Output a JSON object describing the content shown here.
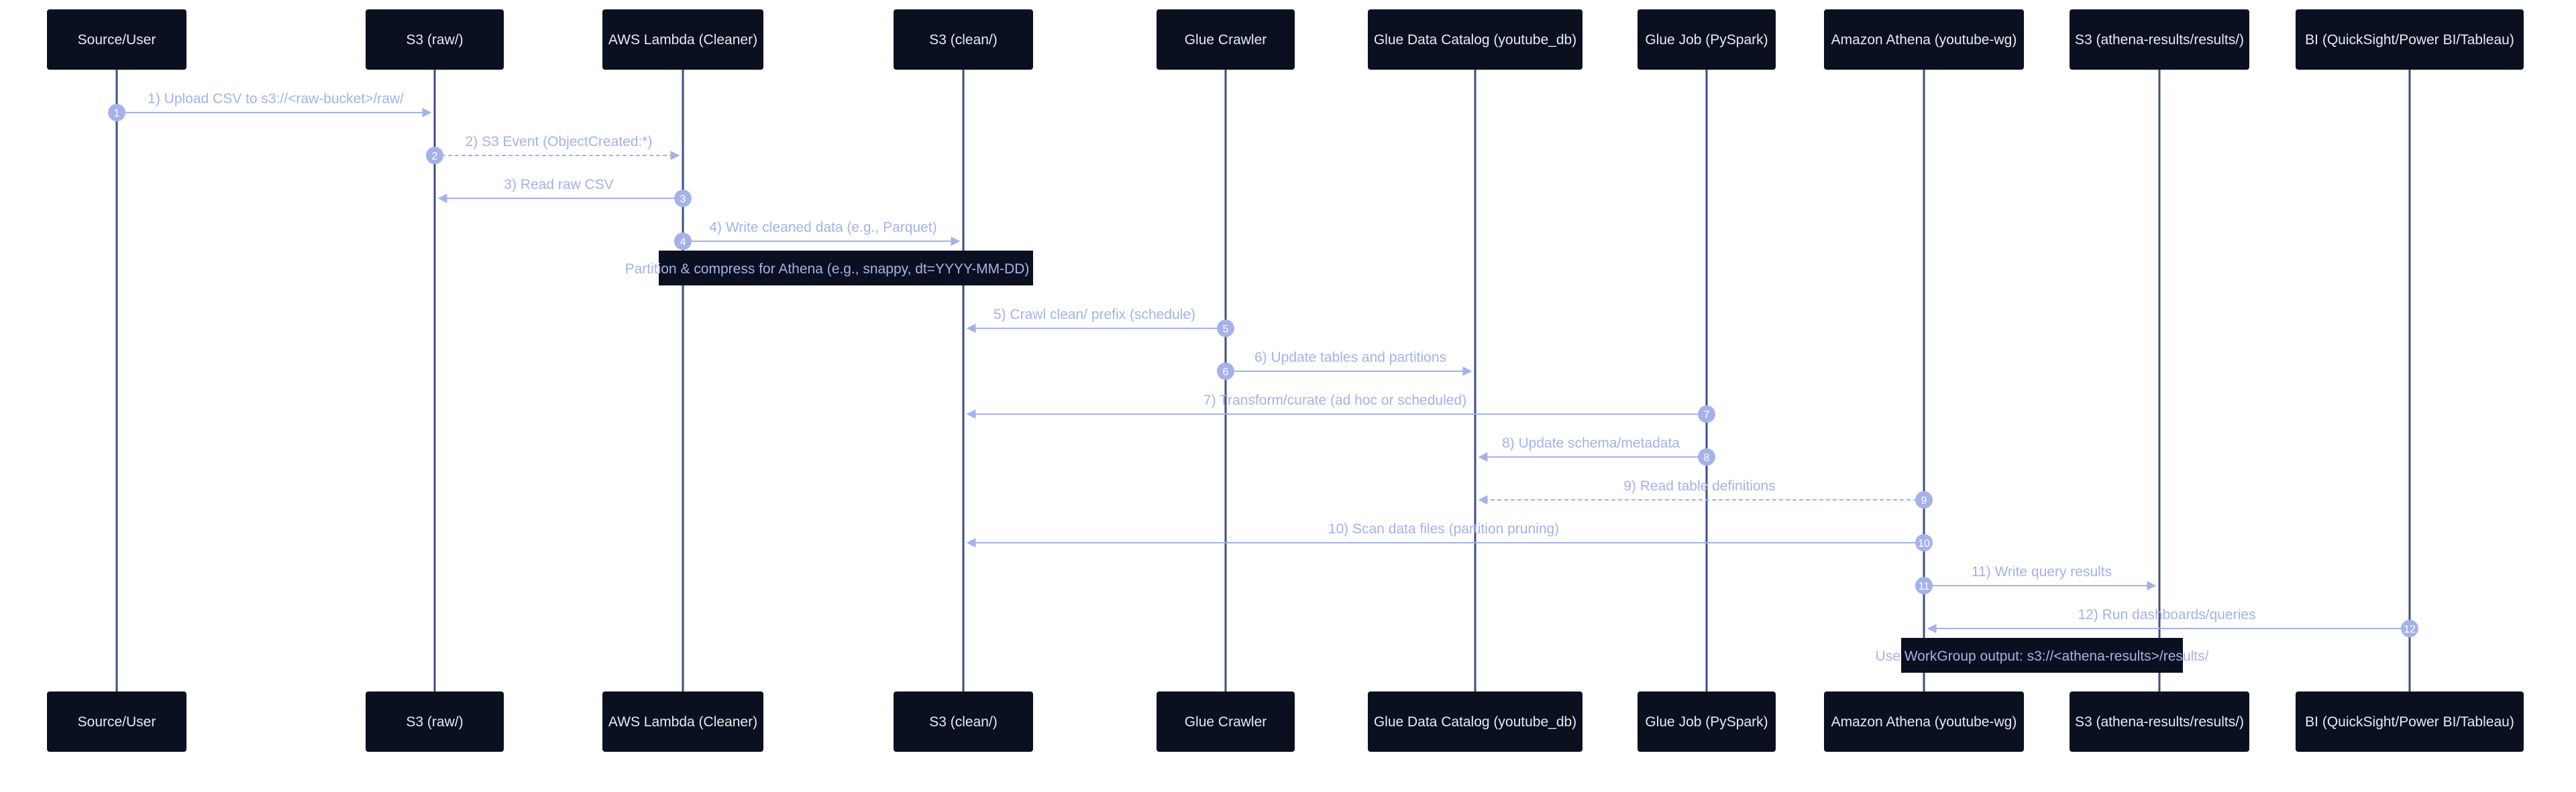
{
  "colors": {
    "actor_fill": "#0b1020",
    "actor_text": "#e8eaf0",
    "lifeline": "#3d4f80",
    "message": "#a5b1e9",
    "number_fill": "#a5b1e9",
    "note_fill": "#0b1020",
    "background": "#ffffff"
  },
  "participants": [
    {
      "id": "source",
      "label": "Source/User"
    },
    {
      "id": "s3raw",
      "label": "S3 (raw/)"
    },
    {
      "id": "lambda",
      "label": "AWS Lambda (Cleaner)"
    },
    {
      "id": "s3clean",
      "label": "S3 (clean/)"
    },
    {
      "id": "crawler",
      "label": "Glue Crawler"
    },
    {
      "id": "catalog",
      "label": "Glue Data Catalog (youtube_db)"
    },
    {
      "id": "gluejob",
      "label": "Glue Job (PySpark)"
    },
    {
      "id": "athena",
      "label": "Amazon Athena (youtube-wg)"
    },
    {
      "id": "results",
      "label": "S3 (athena-results/results/)"
    },
    {
      "id": "bi",
      "label": "BI (QuickSight/Power BI/Tableau)"
    }
  ],
  "messages": [
    {
      "num": "1",
      "from": "source",
      "to": "s3raw",
      "label": "1) Upload CSV to s3://<raw-bucket>/raw/",
      "style": "solid"
    },
    {
      "num": "2",
      "from": "s3raw",
      "to": "lambda",
      "label": "2) S3 Event (ObjectCreated:*)",
      "style": "dashed"
    },
    {
      "num": "3",
      "from": "lambda",
      "to": "s3raw",
      "label": "3) Read raw CSV",
      "style": "solid"
    },
    {
      "num": "4",
      "from": "lambda",
      "to": "s3clean",
      "label": "4) Write cleaned data (e.g., Parquet)",
      "style": "solid"
    },
    {
      "num": "5",
      "from": "crawler",
      "to": "s3clean",
      "label": "5) Crawl clean/ prefix (schedule)",
      "style": "solid"
    },
    {
      "num": "6",
      "from": "crawler",
      "to": "catalog",
      "label": "6) Update tables and partitions",
      "style": "solid"
    },
    {
      "num": "7",
      "from": "gluejob",
      "to": "s3clean",
      "label": "7) Transform/curate (ad hoc or scheduled)",
      "style": "solid"
    },
    {
      "num": "8",
      "from": "gluejob",
      "to": "catalog",
      "label": "8) Update schema/metadata",
      "style": "solid"
    },
    {
      "num": "9",
      "from": "athena",
      "to": "catalog",
      "label": "9) Read table definitions",
      "style": "dashed"
    },
    {
      "num": "10",
      "from": "athena",
      "to": "s3clean",
      "label": "10) Scan data files (partition pruning)",
      "style": "solid"
    },
    {
      "num": "11",
      "from": "athena",
      "to": "results",
      "label": "11) Write query results",
      "style": "solid"
    },
    {
      "num": "12",
      "from": "bi",
      "to": "athena",
      "label": "12) Run dashboards/queries",
      "style": "solid"
    }
  ],
  "notes": [
    {
      "after": "4",
      "over": [
        "lambda",
        "s3clean"
      ],
      "text": "Partition & compress for Athena (e.g., snappy, dt=YYYY-MM-DD)"
    },
    {
      "after": "12",
      "over": [
        "athena",
        "results"
      ],
      "text": "Use WorkGroup output: s3://<athena-results>/results/"
    }
  ]
}
